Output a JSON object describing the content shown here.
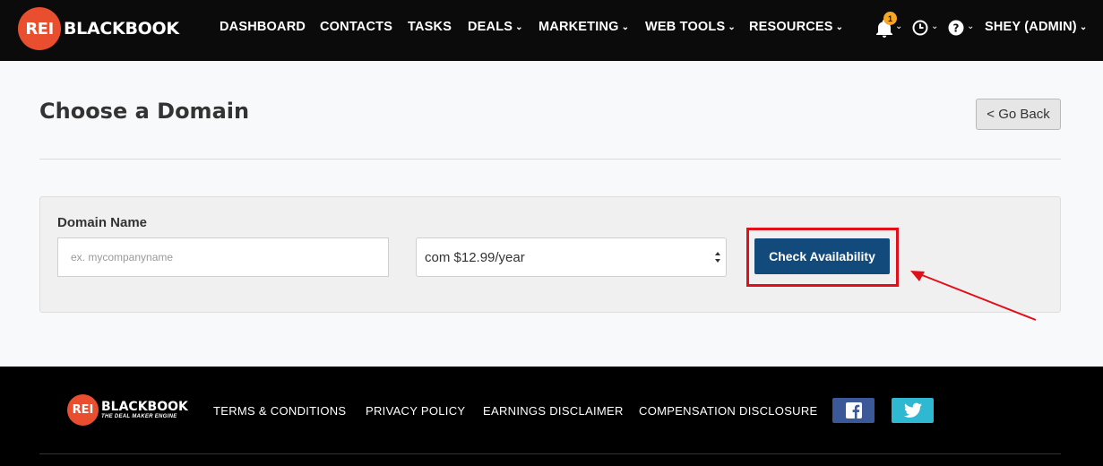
{
  "brand": {
    "logo_mark": "REI",
    "logo_name": "BLACKBOOK",
    "tagline": "THE DEAL MAKER ENGINE",
    "accent": "#e94e2e"
  },
  "nav": {
    "items": [
      {
        "label": "DASHBOARD",
        "dropdown": false
      },
      {
        "label": "CONTACTS",
        "dropdown": false
      },
      {
        "label": "TASKS",
        "dropdown": false
      },
      {
        "label": "DEALS",
        "dropdown": true
      },
      {
        "label": "MARKETING",
        "dropdown": true
      },
      {
        "label": "WEB TOOLS",
        "dropdown": true
      },
      {
        "label": "RESOURCES",
        "dropdown": true
      }
    ],
    "notifications_count": "1",
    "user_label": "SHEY (ADMIN)",
    "icons": [
      "bell-icon",
      "clock-icon",
      "help-icon"
    ]
  },
  "page": {
    "title": "Choose a Domain",
    "back_label": "< Go Back"
  },
  "form": {
    "domain_label": "Domain Name",
    "domain_placeholder": "ex. mycompanyname",
    "domain_value": "",
    "tld_selected": "com $12.99/year",
    "check_button": "Check Availability",
    "button_color": "#114a7b",
    "highlight_color": "#e10f19"
  },
  "footer": {
    "links": [
      "TERMS & CONDITIONS",
      "PRIVACY POLICY",
      "EARNINGS DISCLAIMER",
      "COMPENSATION DISCLOSURE"
    ],
    "social": [
      "facebook-icon",
      "twitter-icon"
    ]
  }
}
